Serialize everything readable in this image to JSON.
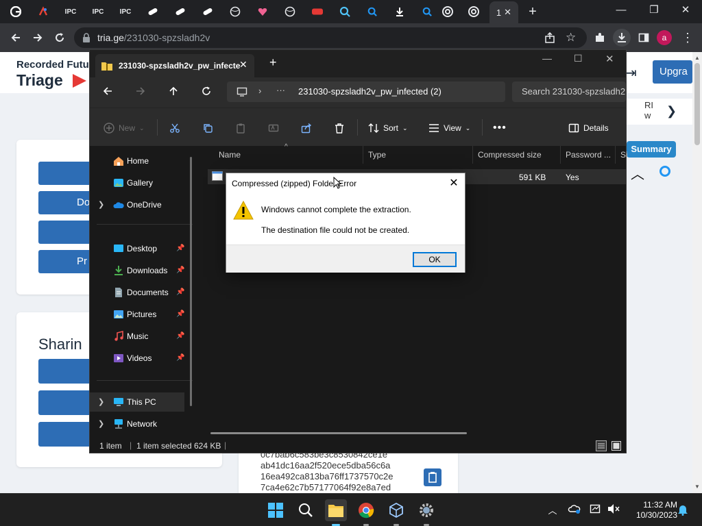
{
  "browser": {
    "active_tab_label": "1",
    "url_host": "tria.ge",
    "url_path": "/231030-spzsladh2v",
    "avatar_letter": "a",
    "tab_fav_labels": [
      "IPC",
      "IPC",
      "IPC"
    ]
  },
  "webpage": {
    "brand_line1": "Recorded Futu",
    "brand_line2": "Triage",
    "upgrade_label": "Upgra",
    "summary_label": "Summary",
    "right_snippet": "RI w",
    "btn_do": "Do",
    "btn_pr": "Pr",
    "sharing_heading": "Sharin",
    "hash_lines": [
      "0c7bab6c583be3c8530842ce1e",
      "ab41dc16aa2f520ece5dba56c6a",
      "16ea492ca813ba76ff1737570c2e",
      "7ca4e62c7b57177064f92e8a7ed"
    ]
  },
  "explorer": {
    "tab_title": "231030-spzsladh2v_pw_infecte",
    "breadcrumb": "231030-spzsladh2v_pw_infected (2)",
    "search_placeholder": "Search 231030-spzsladh2",
    "commands": {
      "new": "New",
      "sort": "Sort",
      "view": "View",
      "details": "Details"
    },
    "nav": {
      "home": "Home",
      "gallery": "Gallery",
      "onedrive": "OneDrive",
      "desktop": "Desktop",
      "downloads": "Downloads",
      "documents": "Documents",
      "pictures": "Pictures",
      "music": "Music",
      "videos": "Videos",
      "thispc": "This PC",
      "network": "Network"
    },
    "columns": {
      "name": "Name",
      "type": "Type",
      "compressed_size": "Compressed size",
      "password": "Password ...",
      "size": "Si"
    },
    "file_row": {
      "compressed_size": "591 KB",
      "password": "Yes"
    },
    "status": {
      "count": "1 item",
      "selected": "1 item selected",
      "size": "624 KB"
    }
  },
  "dialog": {
    "title": "Compressed (zipped) Folder Error",
    "message1": "Windows cannot complete the extraction.",
    "message2": "The destination file could not be created.",
    "ok_label": "OK"
  },
  "taskbar": {
    "time": "11:32 AM",
    "date": "10/30/2023"
  },
  "colors": {
    "chrome_dark": "#202124",
    "explorer_bg": "#191919",
    "accent_blue": "#2d6db5",
    "warning_yellow": "#f4c400"
  }
}
